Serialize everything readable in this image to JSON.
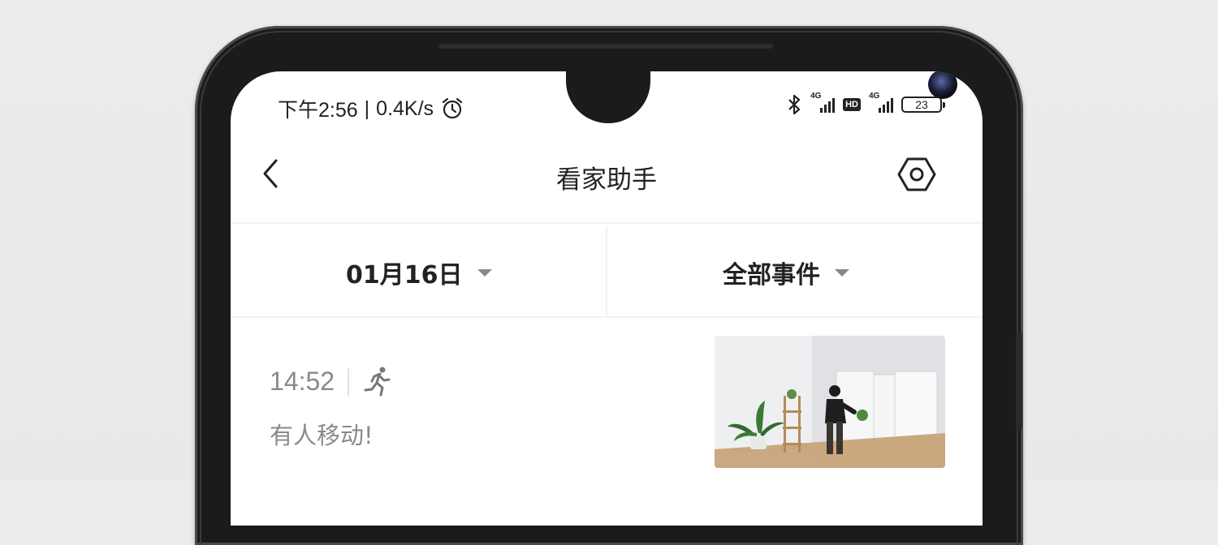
{
  "status_bar": {
    "time": "下午2:56",
    "separator": "|",
    "net_speed": "0.4K/s",
    "sim1_label": "4G",
    "sim2_label": "4G",
    "hd_label": "HD",
    "battery": "23",
    "icons": [
      "alarm-icon",
      "bluetooth-icon",
      "signal-icon",
      "hd-icon",
      "battery-icon"
    ]
  },
  "nav": {
    "title": "看家助手",
    "icons": [
      "back-icon",
      "settings-icon"
    ]
  },
  "filters": {
    "date": "01月16日",
    "event_type": "全部事件"
  },
  "events": [
    {
      "time": "14:52",
      "icon": "running-person-icon",
      "description": "有人移动!"
    }
  ],
  "colors": {
    "text_primary": "#222222",
    "text_secondary": "#8a8a8a",
    "background": "#ffffff"
  }
}
